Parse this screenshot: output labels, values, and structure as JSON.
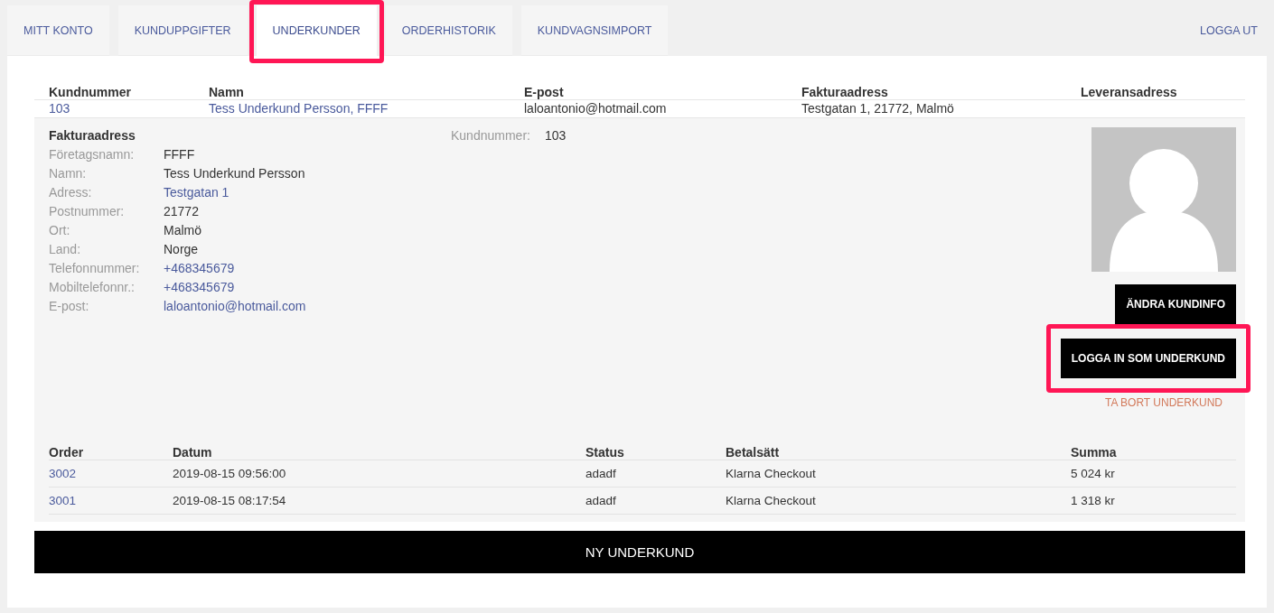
{
  "tabs": [
    {
      "label": "MITT KONTO",
      "selected": false,
      "highlighted": false
    },
    {
      "label": "KUNDUPPGIFTER",
      "selected": false,
      "highlighted": false
    },
    {
      "label": "UNDERKUNDER",
      "selected": true,
      "highlighted": true
    },
    {
      "label": "ORDERHISTORIK",
      "selected": false,
      "highlighted": false
    },
    {
      "label": "KUNDVAGNSIMPORT",
      "selected": false,
      "highlighted": false
    }
  ],
  "logout": "LOGGA UT",
  "customers": {
    "columns": [
      "Kundnummer",
      "Namn",
      "E-post",
      "Fakturaadress",
      "Leveransadress"
    ],
    "rows": [
      {
        "cells": [
          "103",
          "Tess Underkund Persson, FFFF",
          "laloantonio@hotmail.com",
          "Testgatan 1, 21772, Malmö"
        ]
      }
    ]
  },
  "detail": {
    "heading": "Fakturaadress",
    "fields": [
      {
        "label": "Företagsnamn:",
        "value": "FFFF",
        "link": false
      },
      {
        "label": "Namn:",
        "value": "Tess Underkund Persson",
        "link": false
      },
      {
        "label": "Adress:",
        "value": "Testgatan 1",
        "link": true
      },
      {
        "label": "Postnummer:",
        "value": "21772",
        "link": false
      },
      {
        "label": "Ort:",
        "value": "Malmö",
        "link": false
      },
      {
        "label": "Land:",
        "value": "Norge",
        "link": false
      },
      {
        "label": "Telefonnummer:",
        "value": "+468345679",
        "link": true
      },
      {
        "label": "Mobiltelefonnr.:",
        "value": "+468345679",
        "link": true
      },
      {
        "label": "E-post:",
        "value": "laloantonio@hotmail.com",
        "link": true
      }
    ],
    "customer_number": {
      "label": "Kundnummer:",
      "value": "103"
    },
    "buttons": [
      {
        "label": "ÄNDRA KUNDINFO",
        "kind": "primary",
        "highlighted": false
      },
      {
        "label": "LOGGA IN SOM UNDERKUND",
        "kind": "primary",
        "highlighted": true
      },
      {
        "label": "TA BORT UNDERKUND",
        "kind": "danger-link",
        "highlighted": false
      }
    ]
  },
  "orders": {
    "columns": [
      "Order",
      "Datum",
      "Status",
      "Betalsätt",
      "Summa"
    ],
    "rows": [
      {
        "cells": [
          "3002",
          "2019-08-15 09:56:00",
          "adadf",
          "Klarna Checkout",
          "5 024 kr"
        ]
      },
      {
        "cells": [
          "3001",
          "2019-08-15 08:17:54",
          "adadf",
          "Klarna Checkout",
          "1 318 kr"
        ]
      }
    ]
  },
  "new_button": "NY UNDERKUND"
}
